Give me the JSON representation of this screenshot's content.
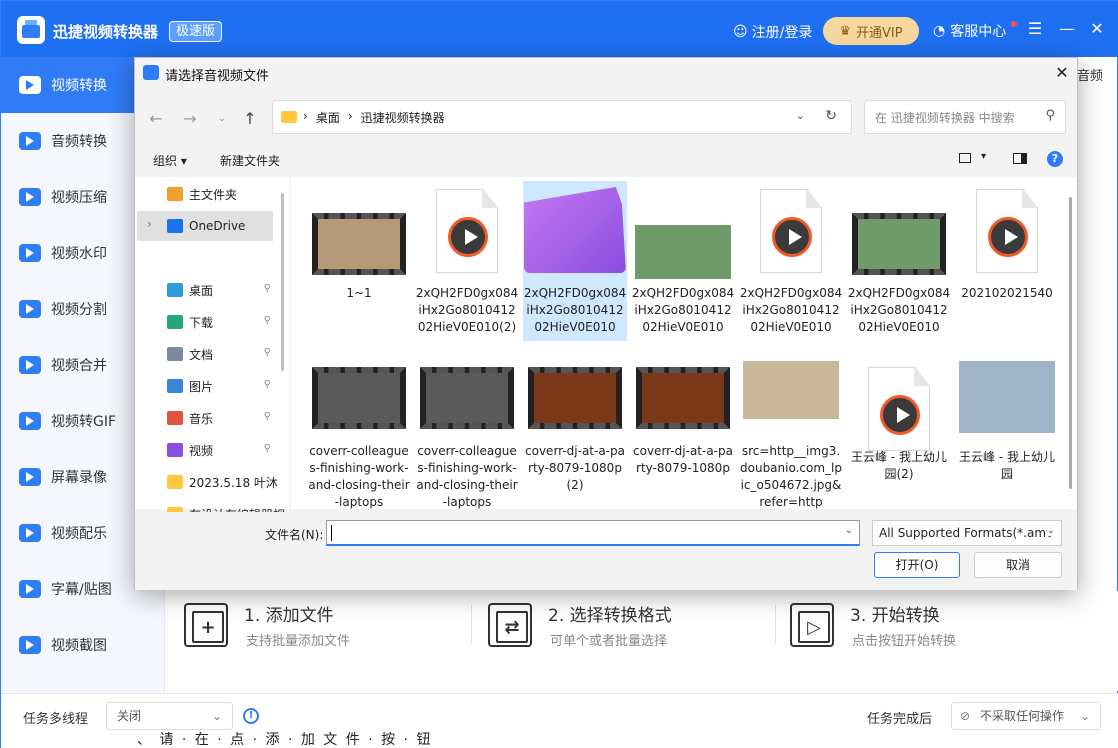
{
  "app": {
    "title": "迅捷视频转换器",
    "edition": "极速版",
    "login": "注册/登录",
    "vip": "开通VIP",
    "support": "客服中心",
    "bg_right_text": "音频",
    "bg_under_text": "、 请 · 在 · 点 · 添 · 加 文 件 · 按 · 钮"
  },
  "sidebar": {
    "items": [
      {
        "label": "视频转换",
        "icon": "video-convert-icon",
        "active": true
      },
      {
        "label": "音频转换",
        "icon": "audio-convert-icon"
      },
      {
        "label": "视频压缩",
        "icon": "video-compress-icon"
      },
      {
        "label": "视频水印",
        "icon": "video-watermark-icon"
      },
      {
        "label": "视频分割",
        "icon": "video-split-icon"
      },
      {
        "label": "视频合并",
        "icon": "video-merge-icon"
      },
      {
        "label": "视频转GIF",
        "icon": "video-gif-icon"
      },
      {
        "label": "屏幕录像",
        "icon": "screen-record-icon"
      },
      {
        "label": "视频配乐",
        "icon": "video-music-icon"
      },
      {
        "label": "字幕/贴图",
        "icon": "subtitle-icon"
      },
      {
        "label": "视频截图",
        "icon": "video-screenshot-icon"
      }
    ]
  },
  "steps": [
    {
      "title": "1. 添加文件",
      "desc": "支持批量添加文件",
      "icon": "+"
    },
    {
      "title": "2. 选择转换格式",
      "desc": "可单个或者批量选择",
      "icon": "⇄"
    },
    {
      "title": "3. 开始转换",
      "desc": "点击按钮开始转换",
      "icon": "▷"
    }
  ],
  "statusbar": {
    "thread_label": "任务多线程",
    "thread_value": "关闭",
    "after_label": "任务完成后",
    "after_value": "不采取任何操作"
  },
  "dialog": {
    "title": "请选择音视频文件",
    "path": [
      "桌面",
      "迅捷视频转换器"
    ],
    "search_placeholder": "在 迅捷视频转换器 中搜索",
    "organize": "组织 ▾",
    "new_folder": "新建文件夹",
    "nav": [
      {
        "label": "主文件夹",
        "icon": "home-icon",
        "color": "#f0a030"
      },
      {
        "label": "OneDrive",
        "icon": "cloud-icon",
        "color": "#1a73e8",
        "selected": true,
        "expand": "›"
      },
      {
        "label": "桌面",
        "icon": "desktop-icon",
        "color": "#2f9bd8",
        "pinned": true
      },
      {
        "label": "下载",
        "icon": "download-icon",
        "color": "#2aa57a",
        "pinned": true
      },
      {
        "label": "文档",
        "icon": "document-icon",
        "color": "#7a8aa0",
        "pinned": true
      },
      {
        "label": "图片",
        "icon": "picture-icon",
        "color": "#3b86d8",
        "pinned": true
      },
      {
        "label": "音乐",
        "icon": "music-icon",
        "color": "#e2543b",
        "pinned": true
      },
      {
        "label": "视频",
        "icon": "video-icon",
        "color": "#8a4ee0",
        "pinned": true
      },
      {
        "label": "2023.5.18 叶沐",
        "icon": "folder-icon",
        "color": "#ffc83d"
      },
      {
        "label": "在设计有编辑器视",
        "icon": "folder-icon",
        "color": "#ffc83d"
      }
    ],
    "files": [
      {
        "name": "1~1",
        "kind": "film",
        "thumb": "#b49a78"
      },
      {
        "name": "2xQH2FD0gx084iHx2Go801041202HieV0E010(2)",
        "kind": "doc"
      },
      {
        "name": "2xQH2FD0gx084iHx2Go801041202HieV0E010",
        "kind": "clap",
        "selected": true
      },
      {
        "name": "2xQH2FD0gx084iHx2Go801041202HieV0E010",
        "kind": "photo",
        "thumb": "#6f9b6a"
      },
      {
        "name": "2xQH2FD0gx084iHx2Go801041202HieV0E010",
        "kind": "doc"
      },
      {
        "name": "2xQH2FD0gx084iHx2Go801041202HieV0E010",
        "kind": "film",
        "thumb": "#6f9b6a"
      },
      {
        "name": "202102021540",
        "kind": "doc"
      },
      {
        "name": "coverr-colleagues-finishing-work-and-closing-their-laptops",
        "kind": "film",
        "thumb": "#5a5a5a"
      },
      {
        "name": "coverr-colleagues-finishing-work-and-closing-their-laptops",
        "kind": "film",
        "thumb": "#5a5a5a"
      },
      {
        "name": "coverr-dj-at-a-party-8079-1080p(2)",
        "kind": "film",
        "thumb": "#7a3a1a"
      },
      {
        "name": "coverr-dj-at-a-party-8079-1080p",
        "kind": "film",
        "thumb": "#7a3a1a"
      },
      {
        "name": "src=http__img3.doubanio.com_lpic_o504672.jpg&refer=http",
        "kind": "photo",
        "thumb": "#c9b79a"
      },
      {
        "name": "王云峰 - 我上幼儿园(2)",
        "kind": "doc"
      },
      {
        "name": "王云峰 - 我上幼儿园",
        "kind": "photo",
        "thumb": "#9fb4c9"
      }
    ],
    "filename_label": "文件名(N):",
    "filename_value": "",
    "format": "All Supported Formats(*.amv",
    "open": "打开(O)",
    "cancel": "取消"
  }
}
